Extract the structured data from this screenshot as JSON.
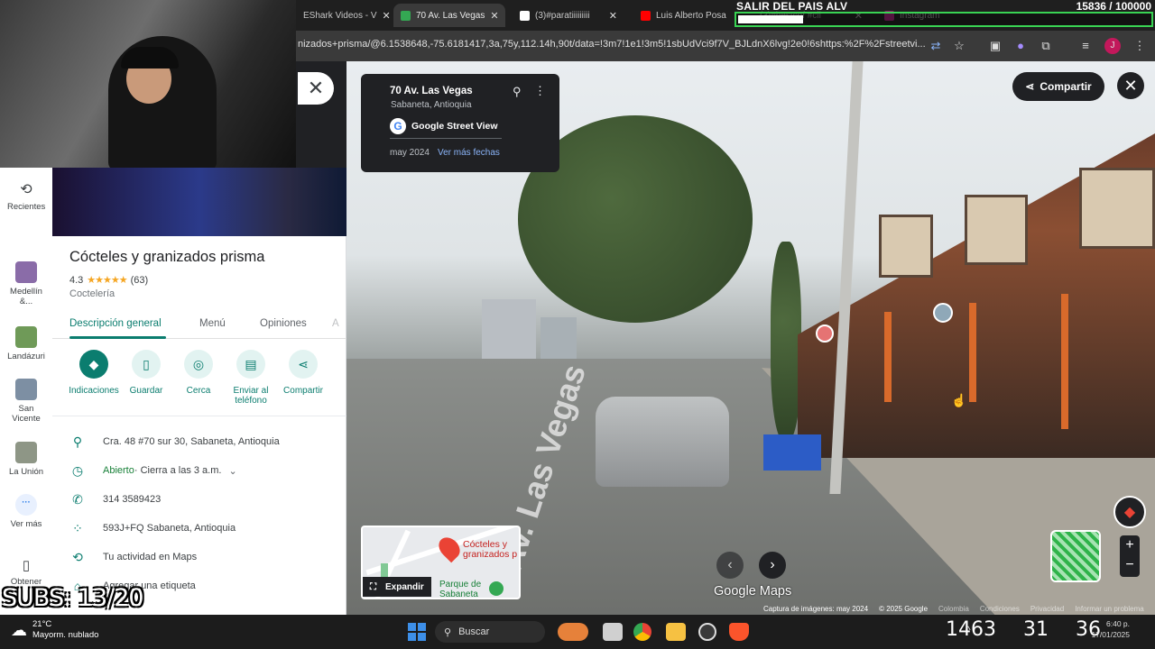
{
  "overlay": {
    "goal_title": "SALIR DEL PAIS ALV",
    "goal_count": "15836 / 100000",
    "goal_progress": 0.158,
    "subs": "SUBS: 13/20"
  },
  "browser": {
    "tabs": [
      {
        "label": "EShark Videos - V",
        "favicon_color": "#ffffff",
        "active": false
      },
      {
        "label": "70 Av. Las Vegas",
        "favicon_color": "#34a853",
        "active": true
      },
      {
        "label": "(3)#paratiiiiiiiii",
        "favicon_color": "#ffffff",
        "active": false
      },
      {
        "label": "Luis Alberto Posa",
        "favicon_color": "#ff0000",
        "active": false
      },
      {
        "label": "(3)#bestcof #cli",
        "favicon_color": "#ffffff",
        "active": false
      },
      {
        "label": "Instagram",
        "favicon_color": "#d6249f",
        "active": false
      }
    ],
    "url": "nizados+prisma/@6.1538648,-75.6181417,3a,75y,112.14h,90t/data=!3m7!1e1!3m5!1sbUdVci9f7V_BJLdnX6lvg!2e0!6shttps:%2F%2Fstreetvi..."
  },
  "rail": {
    "items": [
      {
        "label": "Recientes",
        "icon": "history-icon"
      },
      {
        "label": "Medellín &...",
        "icon": "thumbnail"
      },
      {
        "label": "Landázuri",
        "icon": "thumbnail"
      },
      {
        "label": "San Vicente",
        "icon": "thumbnail"
      },
      {
        "label": "La Unión",
        "icon": "thumbnail"
      },
      {
        "label": "Ver más",
        "icon": "more-icon"
      },
      {
        "label": "Obtener",
        "icon": "phone-icon"
      }
    ]
  },
  "place": {
    "title": "Cócteles y granizados prisma",
    "rating": "4.3",
    "stars": "★★★★★",
    "reviews": "(63)",
    "category": "Coctelería",
    "tabs": [
      "Descripción general",
      "Menú",
      "Opiniones",
      "A"
    ],
    "actions": [
      {
        "label": "Indicaciones",
        "icon": "directions-icon"
      },
      {
        "label": "Guardar",
        "icon": "bookmark-icon"
      },
      {
        "label": "Cerca",
        "icon": "nearby-icon"
      },
      {
        "label": "Enviar al teléfono",
        "icon": "send-to-phone-icon"
      },
      {
        "label": "Compartir",
        "icon": "share-icon"
      }
    ],
    "address": "Cra. 48 #70 sur 30, Sabaneta, Antioquia",
    "hours_status": "Abierto",
    "hours_detail": " · Cierra a las 3 a.m.",
    "phone": "314 3589423",
    "plus_code": "593J+FQ Sabaneta, Antioquia",
    "activity": "Tu actividad en Maps",
    "label_action": "Agregar una etiqueta"
  },
  "streetview": {
    "card_title": "70 Av. Las Vegas",
    "card_subtitle": "Sabaneta, Antioquia",
    "provider": "Google Street View",
    "date": "may 2024",
    "more_dates": "Ver más fechas",
    "share_label": "Compartir",
    "expand_label": "Expandir",
    "minimap_place": "Cócteles y granizados p",
    "minimap_park": "Parque de Sabaneta",
    "logo": "Google Maps",
    "footer": [
      "Captura de imágenes: may 2024",
      "© 2025 Google",
      "Colombia",
      "Condiciones",
      "Privacidad",
      "Informar un problema"
    ]
  },
  "taskbar": {
    "temperature": "21°C",
    "weather": "Mayorm. nublado",
    "search_placeholder": "Buscar",
    "tray_numbers": [
      "1463",
      "31",
      "36"
    ],
    "clock": "6:40 p.",
    "date": "17/01/2025"
  }
}
